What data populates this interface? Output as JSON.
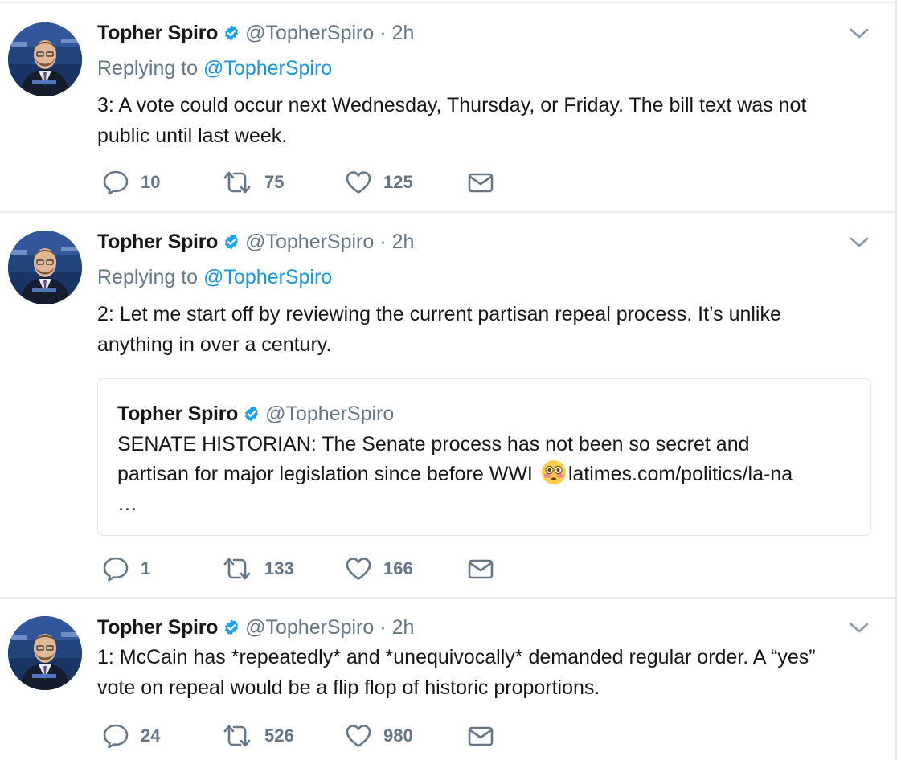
{
  "colors": {
    "name": "#14171a",
    "secondary": "#657786",
    "link": "#1b95e0",
    "verified": "#1da1f2",
    "divider": "#e6ecf0"
  },
  "icons": {
    "reply": "reply-icon",
    "retweet": "retweet-icon",
    "like": "heart-icon",
    "dm": "envelope-icon",
    "menu": "chevron-down-icon",
    "verified": "verified-badge-icon"
  },
  "tweets": [
    {
      "name": "Topher Spiro",
      "handle": "@TopherSpiro",
      "separator": "·",
      "time": "2h",
      "replying_prefix": "Replying to",
      "replying_to": "@TopherSpiro",
      "text_lines": [
        "3: A vote could occur next Wednesday, Thursday, or Friday. The bill text was not",
        "public until last week."
      ],
      "replies": "10",
      "retweets": "75",
      "likes": "125"
    },
    {
      "name": "Topher Spiro",
      "handle": "@TopherSpiro",
      "separator": "·",
      "time": "2h",
      "replying_prefix": "Replying to",
      "replying_to": "@TopherSpiro",
      "text_lines": [
        "2: Let me start off by reviewing the current partisan repeal process. It’s unlike",
        "anything in over a century."
      ],
      "quote": {
        "name": "Topher Spiro",
        "handle": "@TopherSpiro",
        "line1": "SENATE HISTORIAN: The Senate process has not been so secret and",
        "line2_before_emoji": "partisan for major legislation since before WWI",
        "line2_after_emoji": "latimes.com/politics/la-na",
        "line3": "…"
      },
      "replies": "1",
      "retweets": "133",
      "likes": "166"
    },
    {
      "name": "Topher Spiro",
      "handle": "@TopherSpiro",
      "separator": "·",
      "time": "2h",
      "text_lines": [
        "1: McCain has *repeatedly* and *unequivocally* demanded regular order. A “yes”",
        "vote on repeal would be a flip flop of historic proportions."
      ],
      "replies": "24",
      "retweets": "526",
      "likes": "980"
    }
  ]
}
